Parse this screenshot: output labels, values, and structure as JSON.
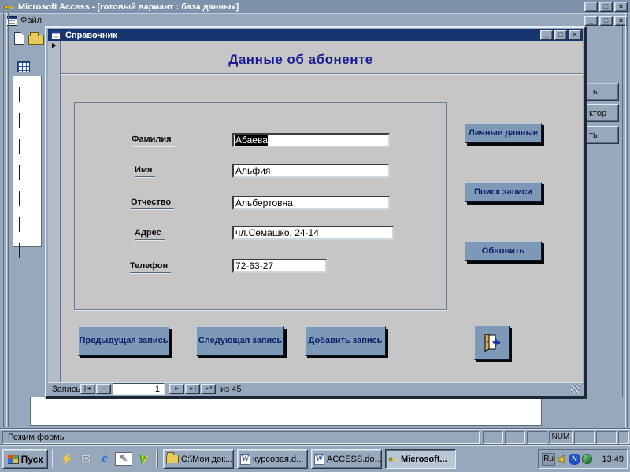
{
  "main_window": {
    "title": "Microsoft Access - [готовый вариант : база данных]",
    "menu": {
      "file": "Файл"
    }
  },
  "window_controls": {
    "minimize": "_",
    "maximize": "□",
    "close": "×"
  },
  "background_db": {
    "buttons": [
      "ть",
      "ктор",
      "ть"
    ]
  },
  "form_window": {
    "title": "Справочник",
    "heading": "Данные об абоненте",
    "record_marker": "►",
    "fields": [
      {
        "label": "Фамилия",
        "value": "Абаева"
      },
      {
        "label": "Имя",
        "value": "Альфия"
      },
      {
        "label": "Отчество",
        "value": "Альбертовна"
      },
      {
        "label": "Адрес",
        "value": "чл.Семашко, 24-14"
      },
      {
        "label": "Телефон",
        "value": "72-63-27"
      }
    ],
    "side_buttons": [
      {
        "label": "Личные данные"
      },
      {
        "label": "Поиск записи"
      },
      {
        "label": "Обновить"
      }
    ],
    "bottom_buttons": [
      {
        "label": "Предыдущая запись"
      },
      {
        "label": "Следующая запись"
      },
      {
        "label": "Добавить запись"
      }
    ],
    "exit_button_icon": "exit-door-icon",
    "record_nav": {
      "label": "Запись:",
      "value": "1",
      "of": "из 45",
      "first": "|◄",
      "prev": "◄",
      "next": "►",
      "last": "►|",
      "new": "►*"
    }
  },
  "status_bar": {
    "mode": "Режим формы",
    "num": "NUM"
  },
  "taskbar": {
    "start": "Пуск",
    "quick_launch_icons": [
      "lightning-icon",
      "mail-icon",
      "internet-explorer-icon",
      "pencil-icon",
      "v-app-icon"
    ],
    "quick_glyphs": {
      "lightning": "⚡",
      "mail": "✉",
      "ie": "e",
      "pencil": "✎",
      "vapp": "V"
    },
    "tasks": [
      {
        "label": "C:\\Мои док...",
        "icon": "folder"
      },
      {
        "label": "курсовая.d...",
        "icon": "word-doc"
      },
      {
        "label": "ACCESS.do...",
        "icon": "word-doc"
      },
      {
        "label": "Microsoft...",
        "icon": "access-key",
        "active": true
      }
    ],
    "tray": {
      "lang": "Ru",
      "shield": "N",
      "time": "13:49"
    }
  },
  "colors": {
    "chrome": "#98a8bc",
    "titlebar_active": "#16356f",
    "titlebar_inactive": "#7e92ac",
    "form_background": "#c6c6c6",
    "button_face": "#7e99b8",
    "button_text": "#0b2268",
    "heading_text": "#1c1c96",
    "selection_bg": "#000000"
  }
}
